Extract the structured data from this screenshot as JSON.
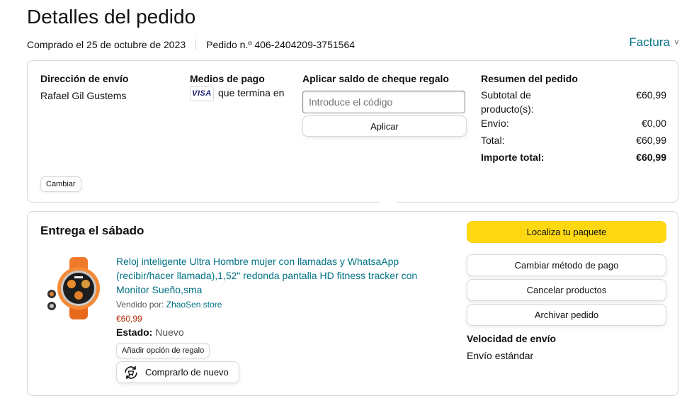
{
  "page": {
    "title": "Detalles del pedido"
  },
  "order_meta": {
    "purchased": "Comprado el 25 de octubre de 2023",
    "order_number": "Pedido n.º 406-2404209-3751564",
    "invoice_label": "Factura",
    "invoice_chevron": "˅"
  },
  "shipping": {
    "title": "Dirección de envío",
    "name": "Rafael Gil Gustems",
    "change_label": "Cambiar"
  },
  "payment": {
    "title": "Medios de pago",
    "card_brand": "VISA",
    "card_text": "que termina en"
  },
  "gift_card": {
    "title": "Aplicar saldo de cheque regalo",
    "placeholder": "Introduce el código",
    "apply_label": "Aplicar"
  },
  "summary": {
    "title": "Resumen del pedido",
    "rows": [
      {
        "label": "Subtotal de producto(s):",
        "value": "€60,99"
      },
      {
        "label": "Envío:",
        "value": "€0,00"
      },
      {
        "label": "Total:",
        "value": "€60,99"
      },
      {
        "label": "Importe total:",
        "value": "€60,99"
      }
    ]
  },
  "delivery": {
    "title": "Entrega el sábado",
    "product": {
      "title": "Reloj inteligente Ultra Hombre mujer con llamadas y WhatsaApp (recibir/hacer llamada),1,52\" redonda pantalla HD fitness tracker con Monitor Sueño,sma",
      "sold_by_label": "Vendido por:",
      "seller": "ZhaoSen store",
      "price": "€60,99",
      "condition_label": "Estado:",
      "condition_value": "Nuevo",
      "gift_option_label": "Añadir opción de regalo",
      "rebuy_label": "Comprarlo de nuevo",
      "image_icon": "smartwatch-orange"
    },
    "actions": {
      "track": "Localiza tu paquete",
      "change_payment": "Cambiar método de pago",
      "cancel": "Cancelar productos",
      "archive": "Archivar pedido"
    },
    "speed": {
      "title": "Velocidad de envío",
      "value": "Envío estándar"
    }
  },
  "colors": {
    "link": "#007185",
    "price": "#b12704",
    "primary_button": "#ffd814",
    "border": "#d5d9d9"
  }
}
